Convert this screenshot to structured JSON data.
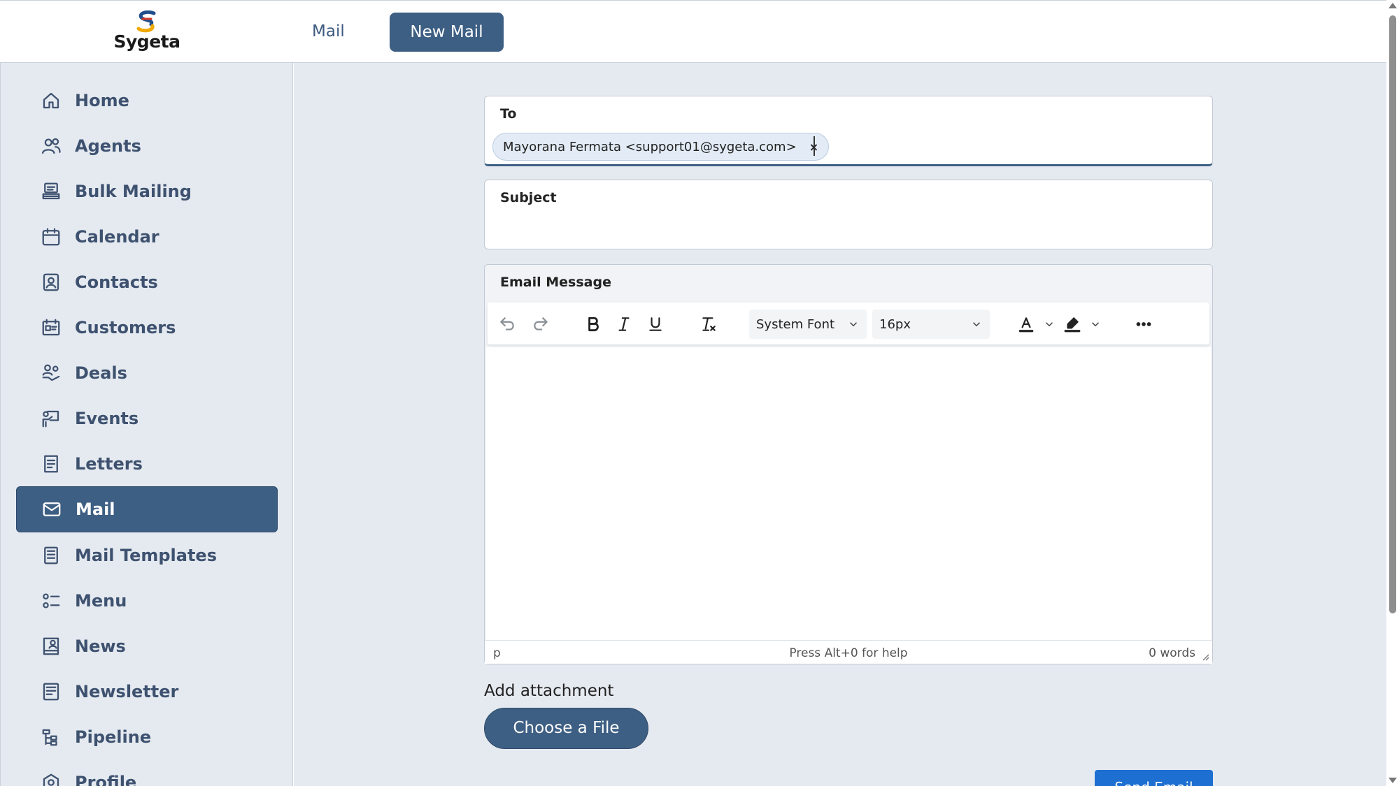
{
  "app": {
    "logo_text": "Sygeta"
  },
  "header": {
    "nav_mail": "Mail",
    "nav_new_mail": "New Mail"
  },
  "sidebar": {
    "items": [
      {
        "label": "Home",
        "icon": "home-icon"
      },
      {
        "label": "Agents",
        "icon": "users-icon"
      },
      {
        "label": "Bulk Mailing",
        "icon": "stack-icon"
      },
      {
        "label": "Calendar",
        "icon": "calendar-icon"
      },
      {
        "label": "Contacts",
        "icon": "contact-card-icon"
      },
      {
        "label": "Customers",
        "icon": "customers-icon"
      },
      {
        "label": "Deals",
        "icon": "deals-icon"
      },
      {
        "label": "Events",
        "icon": "events-icon"
      },
      {
        "label": "Letters",
        "icon": "document-icon"
      },
      {
        "label": "Mail",
        "icon": "envelope-icon",
        "active": true
      },
      {
        "label": "Mail Templates",
        "icon": "template-icon"
      },
      {
        "label": "Menu",
        "icon": "menu-list-icon"
      },
      {
        "label": "News",
        "icon": "news-icon"
      },
      {
        "label": "Newsletter",
        "icon": "newsletter-icon"
      },
      {
        "label": "Pipeline",
        "icon": "pipeline-icon"
      },
      {
        "label": "Profile",
        "icon": "profile-icon"
      }
    ]
  },
  "compose": {
    "to_label": "To",
    "recipient_chip": "Mayorana Fermata <support01@sygeta.com>",
    "chip_remove": "×",
    "subject_label": "Subject",
    "subject_value": "",
    "message_label": "Email Message",
    "toolbar": {
      "font_family": "System Font",
      "font_size": "16px"
    },
    "status": {
      "element_path": "p",
      "help_text": "Press Alt+0 for help",
      "word_count": "0 words"
    },
    "attachment_label": "Add attachment",
    "choose_file_label": "Choose a File",
    "send_label": "Send Email"
  },
  "colors": {
    "primary": "#3e5f84",
    "sidebar_bg": "#e5eaf0",
    "send_blue": "#1d6fd1"
  }
}
